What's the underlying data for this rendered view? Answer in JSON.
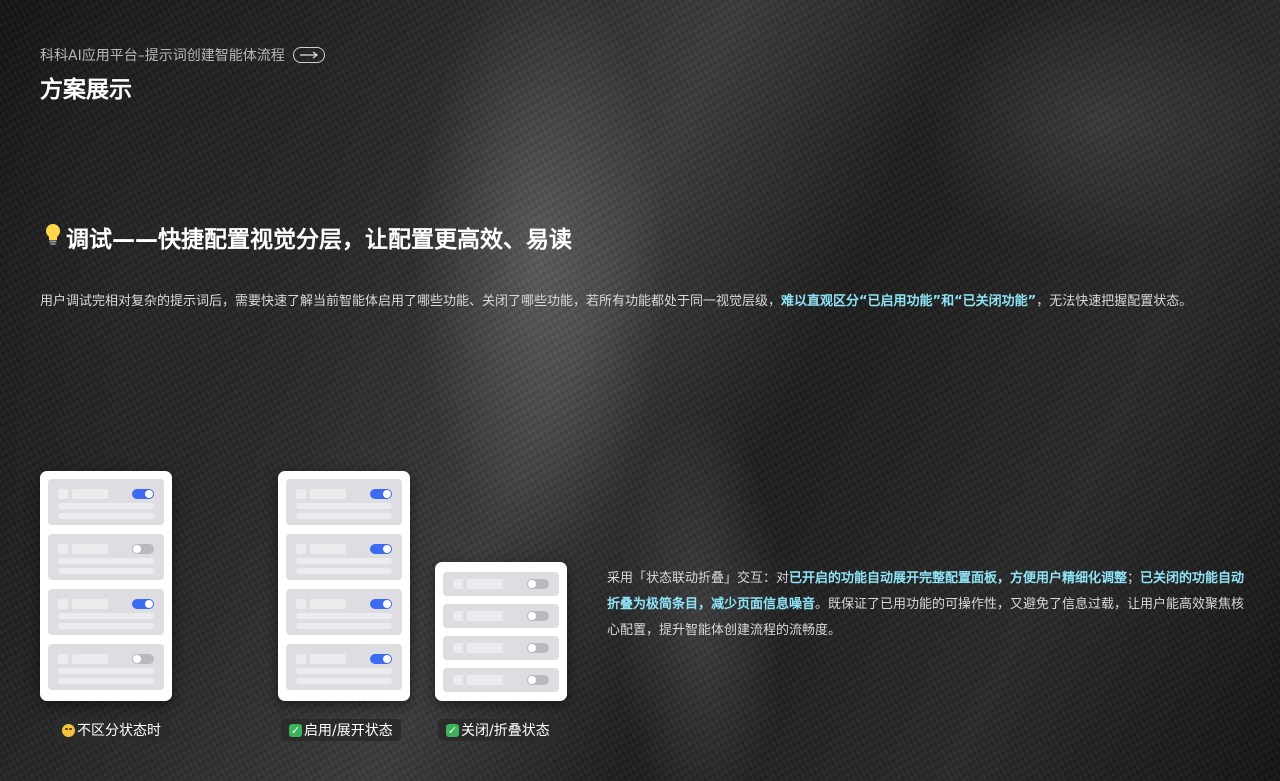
{
  "header": {
    "breadcrumb": "科科AI应用平台–提示词创建智能体流程",
    "page_title": "方案展示"
  },
  "section": {
    "heading": "调试——快捷配置视觉分层，让配置更高效、易读",
    "intro_plain": "用户调试完相对复杂的提示词后，需要快速了解当前智能体启用了哪些功能、关闭了哪些功能，若所有功能都处于同一视觉层级，",
    "intro_highlight": "难以直观区分“已启用功能”和“已关闭功能”",
    "intro_tail": "，无法快速把握配置状态。"
  },
  "cards": [
    {
      "caption": "不区分状态时",
      "caption_icon": "neutral-face-icon",
      "toggles": [
        true,
        false,
        true,
        false
      ]
    },
    {
      "caption": "启用/展开状态",
      "caption_icon": "check-mark-icon",
      "toggles": [
        true,
        true,
        true,
        true
      ]
    },
    {
      "caption": "关闭/折叠状态",
      "caption_icon": "check-mark-icon",
      "toggles": [
        false,
        false,
        false,
        false
      ]
    }
  ],
  "description": {
    "p1": "采用「状态联动折叠」交互：对",
    "hl1": "已开启的功能自动展开完整配置面板，方便用户精细化调整",
    "p2": "；",
    "hl2": "已关闭的功能自动折叠为极简条目，减少页面信息噪音",
    "p3": "。既保证了已用功能的可操作性，又避免了信息过载，让用户能高效聚焦核心配置，提升智能体创建流程的流畅度。"
  },
  "colors": {
    "highlight": "#8ee3f7",
    "toggle_on": "#3d6bf0",
    "toggle_off": "#b9b9bf"
  },
  "icons": {
    "breadcrumb_arrow": "arrow-right-icon",
    "heading_bulb": "light-bulb-icon"
  }
}
